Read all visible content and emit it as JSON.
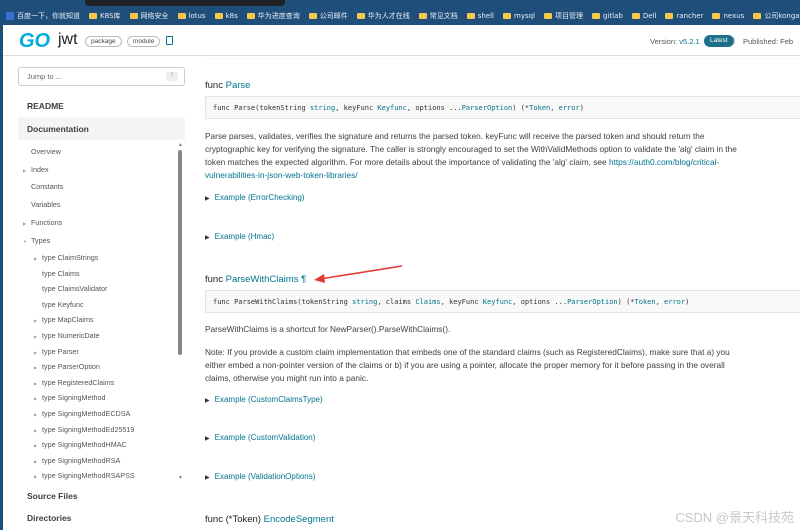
{
  "bookmarks": [
    {
      "label": "百度一下，你就知道",
      "icon": "baidu-icon"
    },
    {
      "label": "K8S库",
      "icon": "folder-icon"
    },
    {
      "label": "网络安全",
      "icon": "folder-icon"
    },
    {
      "label": "lotus",
      "icon": "folder-icon"
    },
    {
      "label": "k8s",
      "icon": "folder-icon"
    },
    {
      "label": "华为进度查询",
      "icon": "folder-icon"
    },
    {
      "label": "公司邮件",
      "icon": "folder-icon"
    },
    {
      "label": "华为人才在线",
      "icon": "folder-icon"
    },
    {
      "label": "常见文档",
      "icon": "folder-icon"
    },
    {
      "label": "shell",
      "icon": "folder-icon"
    },
    {
      "label": "mysql",
      "icon": "folder-icon"
    },
    {
      "label": "项目管理",
      "icon": "folder-icon"
    },
    {
      "label": "gitlab",
      "icon": "folder-icon"
    },
    {
      "label": "Dell",
      "icon": "folder-icon"
    },
    {
      "label": "rancher",
      "icon": "folder-icon"
    },
    {
      "label": "nexus",
      "icon": "folder-icon"
    },
    {
      "label": "公司konga",
      "icon": "folder-icon"
    }
  ],
  "header": {
    "logo": "GO",
    "name": "jwt",
    "chips": [
      "package",
      "module"
    ],
    "version_label": "Version:",
    "version": "v5.2.1",
    "latest": "Latest",
    "separator": "|",
    "published": "Published: Feb"
  },
  "sidebar": {
    "jump_placeholder": "Jump to ...",
    "jump_key": "f",
    "readme": "README",
    "documentation": "Documentation",
    "doc_items": [
      "Overview",
      "Index",
      "Constants",
      "Variables",
      "Functions",
      "Types"
    ],
    "types": [
      "type ClaimStrings",
      "type Claims",
      "type ClaimsValidator",
      "type Keyfunc",
      "type MapClaims",
      "type NumericDate",
      "type Parser",
      "type ParserOption",
      "type RegisteredClaims",
      "type SigningMethod",
      "type SigningMethodECDSA",
      "type SigningMethodEd25519",
      "type SigningMethodHMAC",
      "type SigningMethodRSA",
      "type SigningMethodRSAPSS"
    ],
    "source_files": "Source Files",
    "directories": "Directories"
  },
  "parse": {
    "kw": "func",
    "name": "Parse",
    "sig": [
      "func Parse(tokenString ",
      "string",
      ", keyFunc ",
      "Keyfunc",
      ", options ...",
      "ParserOption",
      ") (*",
      "Token",
      ", ",
      "error",
      ")"
    ],
    "desc": "Parse parses, validates, verifies the signature and returns the parsed token. keyFunc will receive the parsed token and should return the cryptographic key for verifying the signature. The caller is strongly encouraged to set the WithValidMethods option to validate the 'alg' claim in the token matches the expected algorithm. For more details about the importance of validating the 'alg' claim, see",
    "link": "https://auth0.com/blog/critical-vulnerabilities-in-json-web-token-libraries/",
    "examples": [
      "Example (ErrorChecking)",
      "Example (Hmac)"
    ]
  },
  "pwc": {
    "kw": "func",
    "name": "ParseWithClaims",
    "pilcrow": "¶",
    "sig": [
      "func ParseWithClaims(tokenString ",
      "string",
      ", claims ",
      "Claims",
      ", keyFunc ",
      "Keyfunc",
      ", options ...",
      "ParserOption",
      ") (*",
      "Token",
      ", ",
      "error",
      ")"
    ],
    "desc": "ParseWithClaims is a shortcut for NewParser().ParseWithClaims().",
    "note": "Note: If you provide a custom claim implementation that embeds one of the standard claims (such as RegisteredClaims), make sure that a) you either embed a non-pointer version of the claims or b) if you are using a pointer, allocate the proper memory for it before passing in the overall claims, otherwise you might run into a panic.",
    "examples": [
      "Example (CustomClaimsType)",
      "Example (CustomValidation)",
      "Example (ValidationOptions)"
    ]
  },
  "encode": {
    "kw": "func (*Token)",
    "name": "EncodeSegment"
  },
  "watermark": "CSDN @景天科技苑",
  "colors": {
    "accent": "#00758f",
    "go": "#00add8",
    "annotation": "#e53935"
  }
}
